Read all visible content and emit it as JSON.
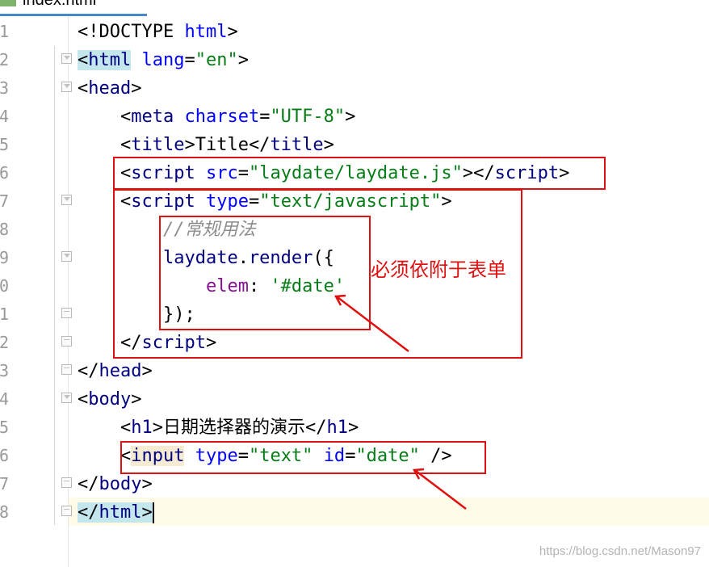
{
  "tab": {
    "label": "index.html"
  },
  "lines": [
    {
      "num": "1",
      "html": "&lt;!DOCTYPE <span class='an'>html</span>&gt;"
    },
    {
      "num": "2",
      "html": "<span class='hl'>&lt;<span class='tg'>html</span></span> <span class='an'>lang</span>=<span class='sv'>\"en\"</span>&gt;"
    },
    {
      "num": "3",
      "html": "&lt;<span class='tg'>head</span>&gt;"
    },
    {
      "num": "4",
      "html": "    &lt;<span class='tg'>meta</span> <span class='an'>charset</span>=<span class='sv'>\"UTF-8\"</span>&gt;"
    },
    {
      "num": "5",
      "html": "    &lt;<span class='tg'>title</span>&gt;Title&lt;/<span class='tg'>title</span>&gt;"
    },
    {
      "num": "6",
      "html": "    &lt;<span class='tg'>script</span> <span class='an'>src</span>=<span class='sv'>\"laydate/laydate.js\"</span>&gt;&lt;/<span class='tg'>script</span>&gt;"
    },
    {
      "num": "7",
      "html": "    &lt;<span class='tg'>script</span> <span class='an'>type</span>=<span class='sv'>\"text/javascript\"</span>&gt;"
    },
    {
      "num": "8",
      "html": "        <span class='cm'>//<span class='cjk'>常规用法</span></span>"
    },
    {
      "num": "9",
      "html": "        <span class='fn'>laydate</span>.<span class='fn'>render</span>({"
    },
    {
      "num": "0",
      "html": "            <span class='pr'>elem</span>: <span class='sv'>'#date'</span>"
    },
    {
      "num": "1",
      "html": "        });"
    },
    {
      "num": "2",
      "html": "    &lt;/<span class='tg'>script</span>&gt;"
    },
    {
      "num": "3",
      "html": "&lt;/<span class='tg'>head</span>&gt;"
    },
    {
      "num": "4",
      "html": "&lt;<span class='tg'>body</span>&gt;"
    },
    {
      "num": "5",
      "html": "    &lt;<span class='tg'>h1</span>&gt;<span class='cjk'>日期选择器的演示</span>&lt;/<span class='tg'>h1</span>&gt;"
    },
    {
      "num": "6",
      "html": "    &lt;<span class='tg hl2'>input</span> <span class='an'>type</span>=<span class='sv'>\"text\"</span> <span class='an'>id</span>=<span class='sv'>\"date\"</span> /&gt;"
    },
    {
      "num": "7",
      "html": "&lt;/<span class='tg'>body</span>&gt;"
    },
    {
      "num": "8",
      "html": "<span class='hl'>&lt;/<span class='tg'>html</span>&gt;</span><span class='caret'></span>"
    }
  ],
  "annotation": {
    "text": "必须依附于表单"
  },
  "watermark": {
    "text": "https://blog.csdn.net/Mason97"
  },
  "colors": {
    "annotation_red": "#e01010",
    "tag": "#000080",
    "attr": "#0000ff",
    "string": "#067d17",
    "comment": "#8c8c8c"
  }
}
